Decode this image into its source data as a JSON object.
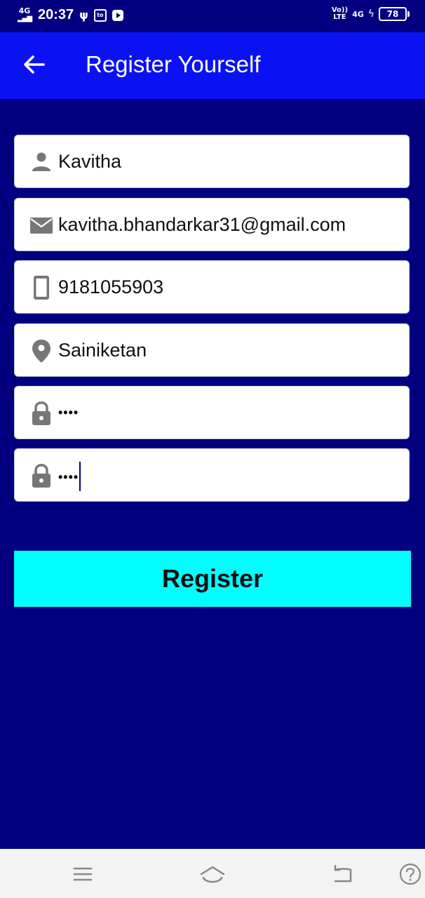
{
  "status_bar": {
    "network_left": "4G",
    "time": "20:37",
    "volte": "Vo))",
    "lte": "LTE",
    "network_right": "4G",
    "battery": "78"
  },
  "app_bar": {
    "title": "Register Yourself",
    "back_icon": "arrow-left-icon"
  },
  "form": {
    "fields": [
      {
        "icon": "person-icon",
        "value": "Kavitha"
      },
      {
        "icon": "mail-icon",
        "value": "kavitha.bhandarkar31@gmail.com"
      },
      {
        "icon": "phone-icon",
        "value": "9181055903"
      },
      {
        "icon": "location-pin-icon",
        "value": "Sainiketan"
      },
      {
        "icon": "lock-icon",
        "value": "••••"
      },
      {
        "icon": "lock-icon",
        "value": "••••"
      }
    ],
    "register_label": "Register"
  },
  "colors": {
    "background": "#020080",
    "app_bar": "#0a12f5",
    "button": "#00ffff",
    "icon": "#777777"
  },
  "nav_bar": {
    "icons": [
      "menu-icon",
      "home-icon",
      "back-icon",
      "help-icon"
    ]
  }
}
